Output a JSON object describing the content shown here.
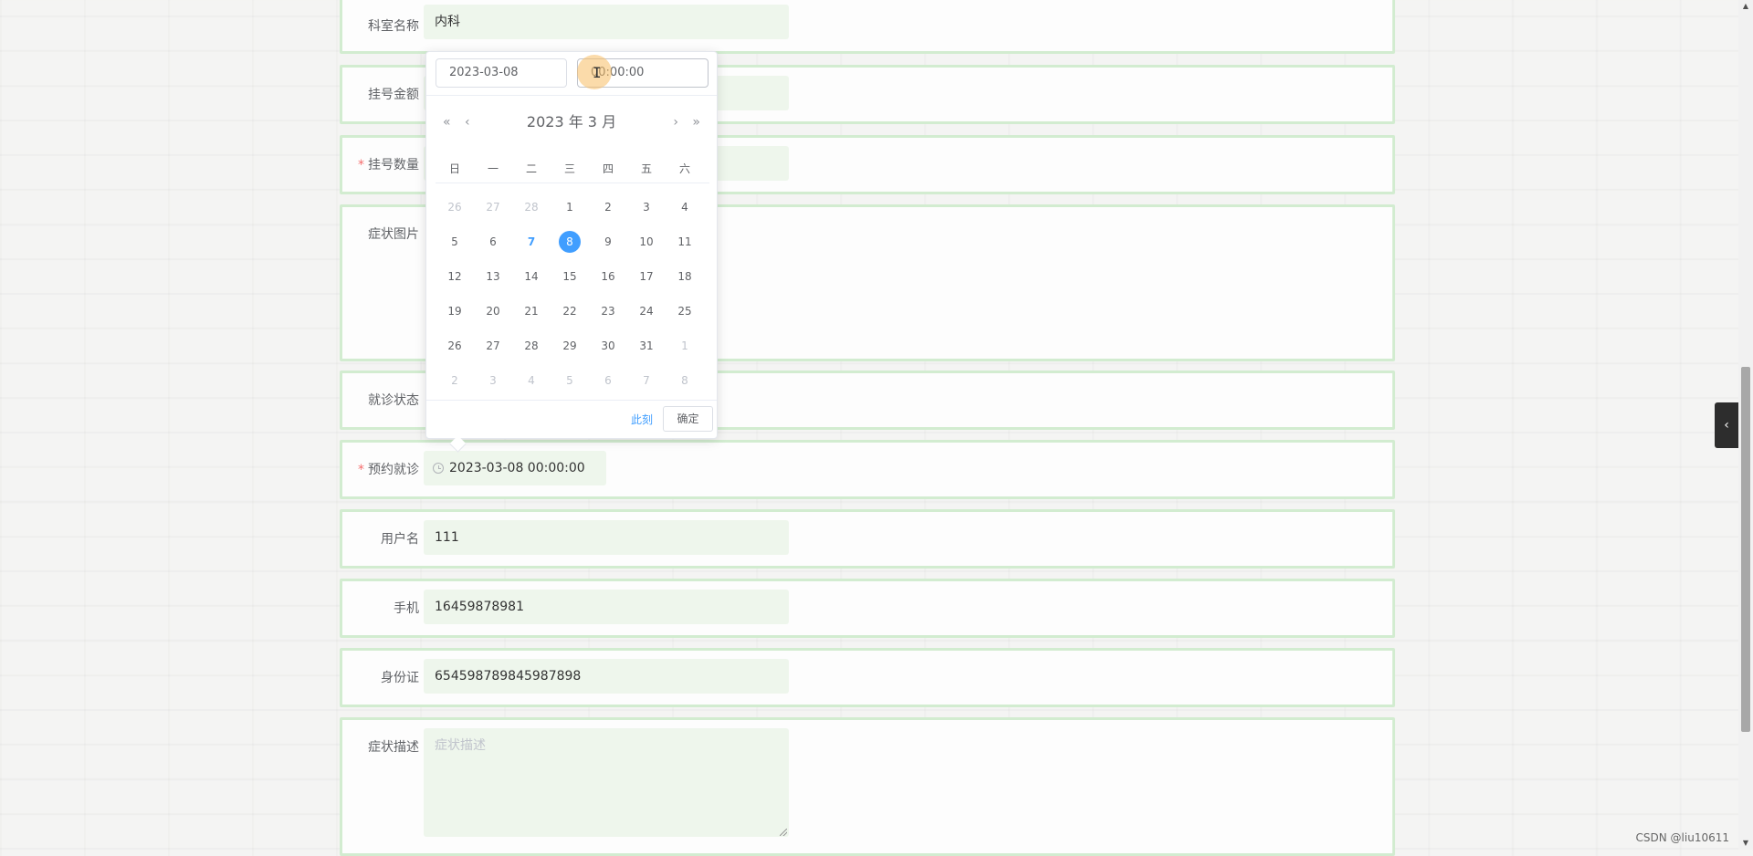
{
  "form": {
    "dept": {
      "label": "科室名称",
      "value": "内科"
    },
    "fee": {
      "label": "挂号金额",
      "value": ""
    },
    "quantity": {
      "label": "挂号数量",
      "value": ""
    },
    "image": {
      "label": "症状图片"
    },
    "status": {
      "label": "就诊状态",
      "value": ""
    },
    "appointment": {
      "label": "预约就诊",
      "value": "2023-03-08 00:00:00"
    },
    "username": {
      "label": "用户名",
      "value": "111"
    },
    "phone": {
      "label": "手机",
      "value": "16459878981"
    },
    "idcard": {
      "label": "身份证",
      "value": "654598789845987898"
    },
    "symptom": {
      "label": "症状描述",
      "placeholder": "症状描述"
    },
    "required_mark": "*"
  },
  "picker": {
    "date_input": "2023-03-08",
    "time_input": "00:00:00",
    "title": "2023 年  3 月",
    "nav": {
      "prev_year": "«",
      "prev_month": "‹",
      "next_month": "›",
      "next_year": "»"
    },
    "weekdays": [
      "日",
      "一",
      "二",
      "三",
      "四",
      "五",
      "六"
    ],
    "weeks": [
      [
        {
          "d": "26",
          "t": "other"
        },
        {
          "d": "27",
          "t": "other"
        },
        {
          "d": "28",
          "t": "other"
        },
        {
          "d": "1",
          "t": ""
        },
        {
          "d": "2",
          "t": ""
        },
        {
          "d": "3",
          "t": ""
        },
        {
          "d": "4",
          "t": ""
        }
      ],
      [
        {
          "d": "5",
          "t": ""
        },
        {
          "d": "6",
          "t": ""
        },
        {
          "d": "7",
          "t": "today"
        },
        {
          "d": "8",
          "t": "selected"
        },
        {
          "d": "9",
          "t": ""
        },
        {
          "d": "10",
          "t": ""
        },
        {
          "d": "11",
          "t": ""
        }
      ],
      [
        {
          "d": "12",
          "t": ""
        },
        {
          "d": "13",
          "t": ""
        },
        {
          "d": "14",
          "t": ""
        },
        {
          "d": "15",
          "t": ""
        },
        {
          "d": "16",
          "t": ""
        },
        {
          "d": "17",
          "t": ""
        },
        {
          "d": "18",
          "t": ""
        }
      ],
      [
        {
          "d": "19",
          "t": ""
        },
        {
          "d": "20",
          "t": ""
        },
        {
          "d": "21",
          "t": ""
        },
        {
          "d": "22",
          "t": ""
        },
        {
          "d": "23",
          "t": ""
        },
        {
          "d": "24",
          "t": ""
        },
        {
          "d": "25",
          "t": ""
        }
      ],
      [
        {
          "d": "26",
          "t": ""
        },
        {
          "d": "27",
          "t": ""
        },
        {
          "d": "28",
          "t": ""
        },
        {
          "d": "29",
          "t": ""
        },
        {
          "d": "30",
          "t": ""
        },
        {
          "d": "31",
          "t": ""
        },
        {
          "d": "1",
          "t": "other"
        }
      ],
      [
        {
          "d": "2",
          "t": "other"
        },
        {
          "d": "3",
          "t": "other"
        },
        {
          "d": "4",
          "t": "other"
        },
        {
          "d": "5",
          "t": "other"
        },
        {
          "d": "6",
          "t": "other"
        },
        {
          "d": "7",
          "t": "other"
        },
        {
          "d": "8",
          "t": "other"
        }
      ]
    ],
    "now_label": "此刻",
    "ok_label": "确定"
  },
  "side_tab_icon": "‹",
  "watermark": "CSDN @liu10611",
  "colors": {
    "accent": "#409eff",
    "row_border": "#d2ecd0",
    "field_bg": "#eef6ec",
    "required": "#f56c6c"
  }
}
